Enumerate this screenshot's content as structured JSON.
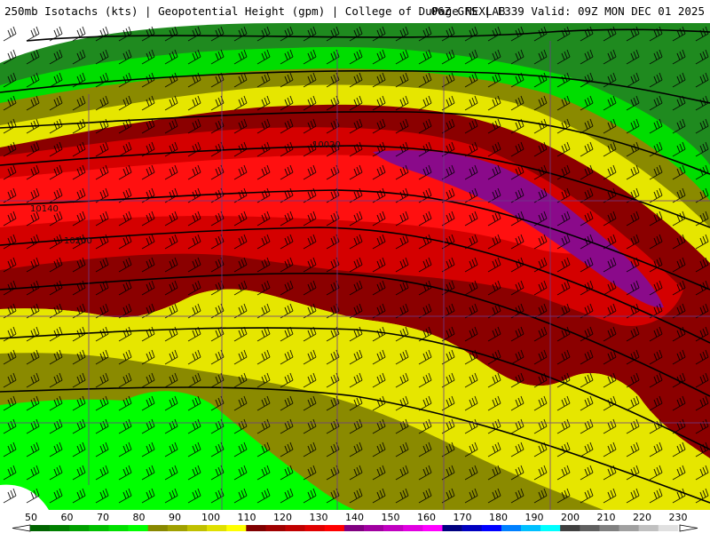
{
  "header": {
    "left": "250mb Isotachs (kts) | Geopotential Height (gpm) | College of DuPage NEXLAB",
    "right": "06Z GFS | F339 Valid: 09Z MON DEC 01 2025"
  },
  "contour_labels": [
    "10020",
    "10140",
    "10200"
  ],
  "legend": {
    "labels": [
      "50",
      "60",
      "70",
      "80",
      "90",
      "100",
      "110",
      "120",
      "130",
      "140",
      "150",
      "160",
      "170",
      "180",
      "190",
      "200",
      "210",
      "220",
      "230"
    ],
    "colors": [
      "#006400",
      "#008000",
      "#00a000",
      "#00c000",
      "#00e000",
      "#00ff00",
      "#888800",
      "#a0a000",
      "#c0c000",
      "#e0e000",
      "#ffff00",
      "#800000",
      "#a00000",
      "#c00000",
      "#e00000",
      "#ff0000",
      "#800080",
      "#a000a0",
      "#c000c0",
      "#e000e0",
      "#ff00ff",
      "#000080",
      "#0000c0",
      "#0000ff",
      "#0080ff",
      "#00c0ff",
      "#00ffff",
      "#404040",
      "#606060",
      "#808080",
      "#a0a0a0",
      "#c0c0c0",
      "#e0e0e0",
      "#ffffff"
    ]
  },
  "colors": {
    "green_dark": "#1f8a1f",
    "green": "#00dd00",
    "green_bright": "#00ff00",
    "olive": "#8a8a00",
    "yellow": "#e6e600",
    "red_dark": "#8b0000",
    "red": "#d40000",
    "red_bright": "#ff1010",
    "purple": "#8a0a8a"
  }
}
